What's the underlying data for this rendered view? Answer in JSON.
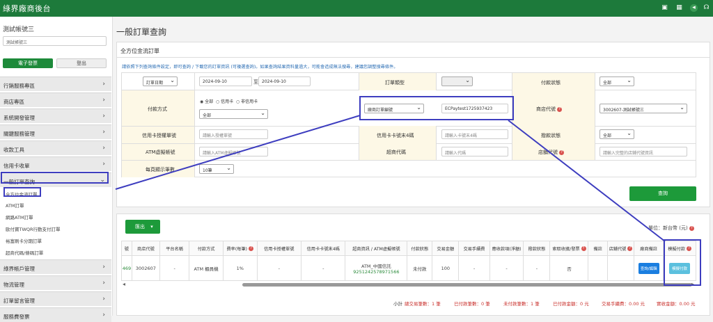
{
  "app": {
    "title": "綠界廠商後台"
  },
  "sidebar": {
    "account": "測試帳號三",
    "account_select": "測試帳號三",
    "btn_invoice": "電子發票",
    "btn_logout": "登出",
    "items": [
      "行銷服務專區",
      "商店專區",
      "系統開發管理",
      "關鍵服務管理",
      "收款工具",
      "信用卡收單",
      "一般訂單查詢",
      "綠界帳戶管理",
      "物流管理",
      "訂單留言管理",
      "服務費發票"
    ],
    "subitems": [
      "全方位金流訂單",
      "ATM訂單",
      "網路ATM訂單",
      "歐付寶TWQR行動支付訂單",
      "裕富刷卡分期訂單",
      "超商代碼/條碼訂單"
    ]
  },
  "page": {
    "title": "一般訂單查詢",
    "panel_title": "全方位金流訂單",
    "info": "請依照下列查詢條件設定，即可查詢 / 下載您的訂單資訊 (可複選查詢)。如果查詢結果資料量過大，可能會造成無法搜尋，建議您調整搜尋條件。"
  },
  "filters": {
    "date_type": "訂單日期",
    "date_from": "2024-09-10",
    "date_sep": "至",
    "date_to": "2024-09-10",
    "order_type_label": "訂單類型",
    "pay_status_label": "付款狀態",
    "pay_status": "全部",
    "pay_method_label": "付款方式",
    "radio_all": "全部",
    "radio_credit": "信用卡",
    "radio_noncredit": "非信用卡",
    "pay_method_select": "全部",
    "search_by": "廠商訂單編號",
    "search_value": "ECPaytest1725937423",
    "store_code_label": "商店代號",
    "store_code": "3002607-測試帳號三",
    "credit_auth_label": "信用卡授權單號",
    "credit_auth_ph": "請輸入授權單號",
    "credit_last4_label": "信用卡卡號末4碼",
    "credit_last4_ph": "請輸入卡號末4碼",
    "refund_status_label": "撥款狀態",
    "refund_status": "全部",
    "atm_label": "ATM虛擬帳號",
    "atm_ph": "請輸入ATM虛擬帳號",
    "cvs_label": "超商代碼",
    "cvs_ph": "請輸入代碼",
    "store_id_label": "店舖代號",
    "store_id_ph": "請輸入完整的店鋪代號資訊",
    "page_size_label": "每頁顯示筆數",
    "page_size": "10筆",
    "query_button": "查詢"
  },
  "results": {
    "export_button": "匯出",
    "unit": "單位：新台幣 (元)",
    "headers": [
      "號",
      "商店代號",
      "平台名稱",
      "付款方式",
      "費率(每筆)",
      "信用卡授權單號",
      "信用卡卡號末4碼",
      "超商資訊 / ATM虛擬帳號",
      "付款狀態",
      "交易金額",
      "交易手續費",
      "應收款項(淨額)",
      "撥款狀態",
      "索取收據/發票",
      "備註",
      "店舖代號",
      "廠商備註",
      "模擬付款"
    ],
    "row": {
      "order_no": "469",
      "store": "3002607",
      "platform": "-",
      "method": "ATM 櫃員機",
      "rate": "1%",
      "auth": "-",
      "last4": "-",
      "atm_bank": "ATM_中國信託",
      "atm_account": "9251242578971566",
      "status": "未付款",
      "amount": "100",
      "fee": "-",
      "net": "-",
      "refund": "-",
      "invoice": "否",
      "note": "",
      "store_id": "",
      "vendor_btn": "查詢/編輯",
      "simulate_btn": "模擬付款"
    }
  },
  "footer": {
    "subtotal": "小計",
    "total_count": "總交易筆數：1 筆",
    "paid_count": "已付款筆數：0 筆",
    "unpaid_count": "未付款筆數：1 筆",
    "paid_amount": "已付款金額：0 元",
    "fee_total": "交易手續費：0.00 元",
    "receivable": "實收金額：0.00 元"
  }
}
